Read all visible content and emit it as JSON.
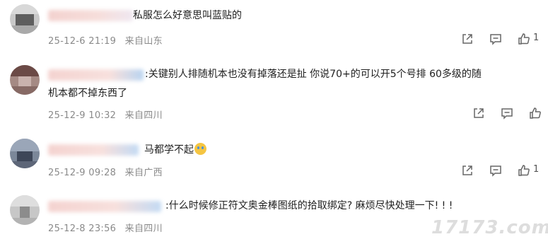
{
  "comments": [
    {
      "text": "私服怎么好意思叫蓝贴的",
      "date": "25-12-6 21:19",
      "location": "来自山东",
      "likes": "1"
    },
    {
      "text_line1": ":关键别人排随机本也没有掉落还是扯 你说70+的可以开5个号排 60多级的随",
      "text_line2": "机本都不掉东西了",
      "date": "25-12-9 10:32",
      "location": "来自四川",
      "likes": ""
    },
    {
      "text": "马都学不起",
      "date": "25-12-9 09:28",
      "location": "来自广西",
      "likes": "1"
    },
    {
      "text": ":什么时候修正符文奥金棒图纸的拾取绑定? 麻烦尽快处理一下! ! !",
      "date": "25-12-8 23:56",
      "location": "来自四川",
      "likes": ""
    }
  ],
  "icons": {
    "share": "share-icon",
    "reply": "comment-icon",
    "like": "thumbs-up-icon",
    "emoji": "fearful-face-emoji"
  },
  "watermark": "17173.com"
}
